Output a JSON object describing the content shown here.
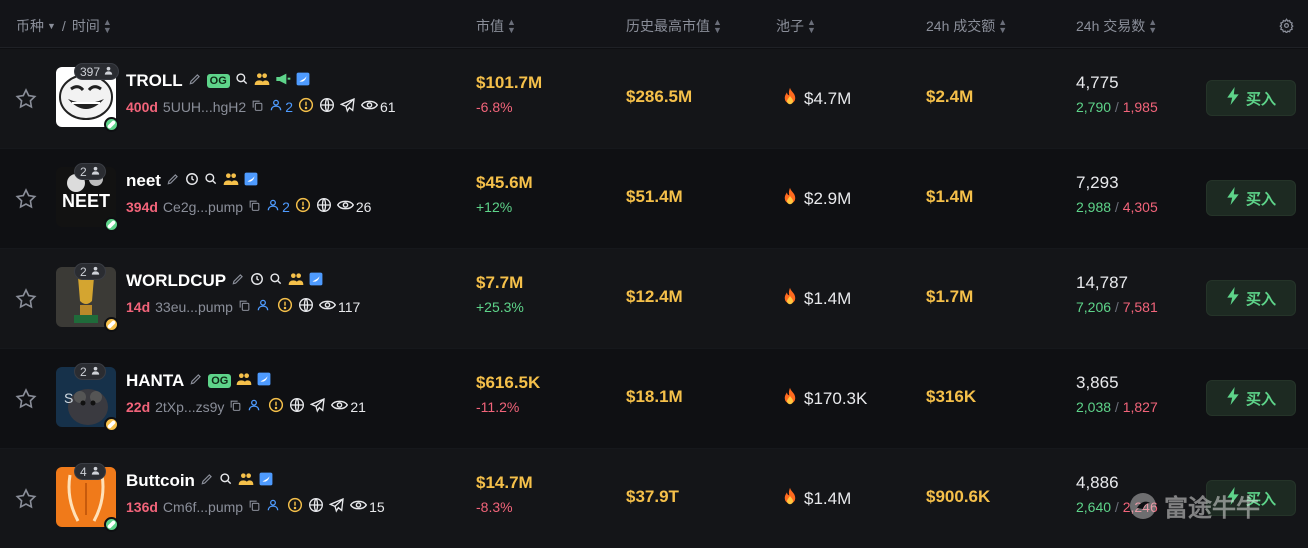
{
  "header": {
    "coin": "币种",
    "separator": "/",
    "time": "时间",
    "market_cap": "市值",
    "ath_market_cap": "历史最高市值",
    "pool": "池子",
    "volume_24h": "24h 成交额",
    "txns_24h": "24h 交易数"
  },
  "buy_label": "买入",
  "watermark": "富途牛牛",
  "colors": {
    "accent_yellow": "#f5c04a",
    "up_green": "#5ed48a",
    "down_red": "#f2647a",
    "link_blue": "#4e9bff"
  },
  "tokens": [
    {
      "name": "TROLL",
      "og": "OG",
      "holders_badge": "397",
      "age": "400d",
      "address": "5UUH...hgH2",
      "dev_count": "2",
      "views": "61",
      "market_cap": "$101.7M",
      "mc_change": "-6.8%",
      "ath": "$286.5M",
      "pool": "$4.7M",
      "volume": "$2.4M",
      "txns": "4,775",
      "buys": "2,790",
      "sells": "1,985"
    },
    {
      "name": "neet",
      "og": "",
      "holders_badge": "2",
      "age": "394d",
      "address": "Ce2g...pump",
      "dev_count": "2",
      "views": "26",
      "market_cap": "$45.6M",
      "mc_change": "+12%",
      "ath": "$51.4M",
      "pool": "$2.9M",
      "volume": "$1.4M",
      "txns": "7,293",
      "buys": "2,988",
      "sells": "4,305"
    },
    {
      "name": "WORLDCUP",
      "og": "",
      "holders_badge": "2",
      "age": "14d",
      "address": "33eu...pump",
      "dev_count": "",
      "views": "117",
      "market_cap": "$7.7M",
      "mc_change": "+25.3%",
      "ath": "$12.4M",
      "pool": "$1.4M",
      "volume": "$1.7M",
      "txns": "14,787",
      "buys": "7,206",
      "sells": "7,581"
    },
    {
      "name": "HANTA",
      "og": "OG",
      "holders_badge": "2",
      "age": "22d",
      "address": "2tXp...zs9y",
      "dev_count": "",
      "views": "21",
      "market_cap": "$616.5K",
      "mc_change": "-11.2%",
      "ath": "$18.1M",
      "pool": "$170.3K",
      "volume": "$316K",
      "txns": "3,865",
      "buys": "2,038",
      "sells": "1,827"
    },
    {
      "name": "Buttcoin",
      "og": "",
      "holders_badge": "4",
      "age": "136d",
      "address": "Cm6f...pump",
      "dev_count": "",
      "views": "15",
      "market_cap": "$14.7M",
      "mc_change": "-8.3%",
      "ath": "$37.9T",
      "pool": "$1.4M",
      "volume": "$900.6K",
      "txns": "4,886",
      "buys": "2,640",
      "sells": "2,246"
    }
  ]
}
